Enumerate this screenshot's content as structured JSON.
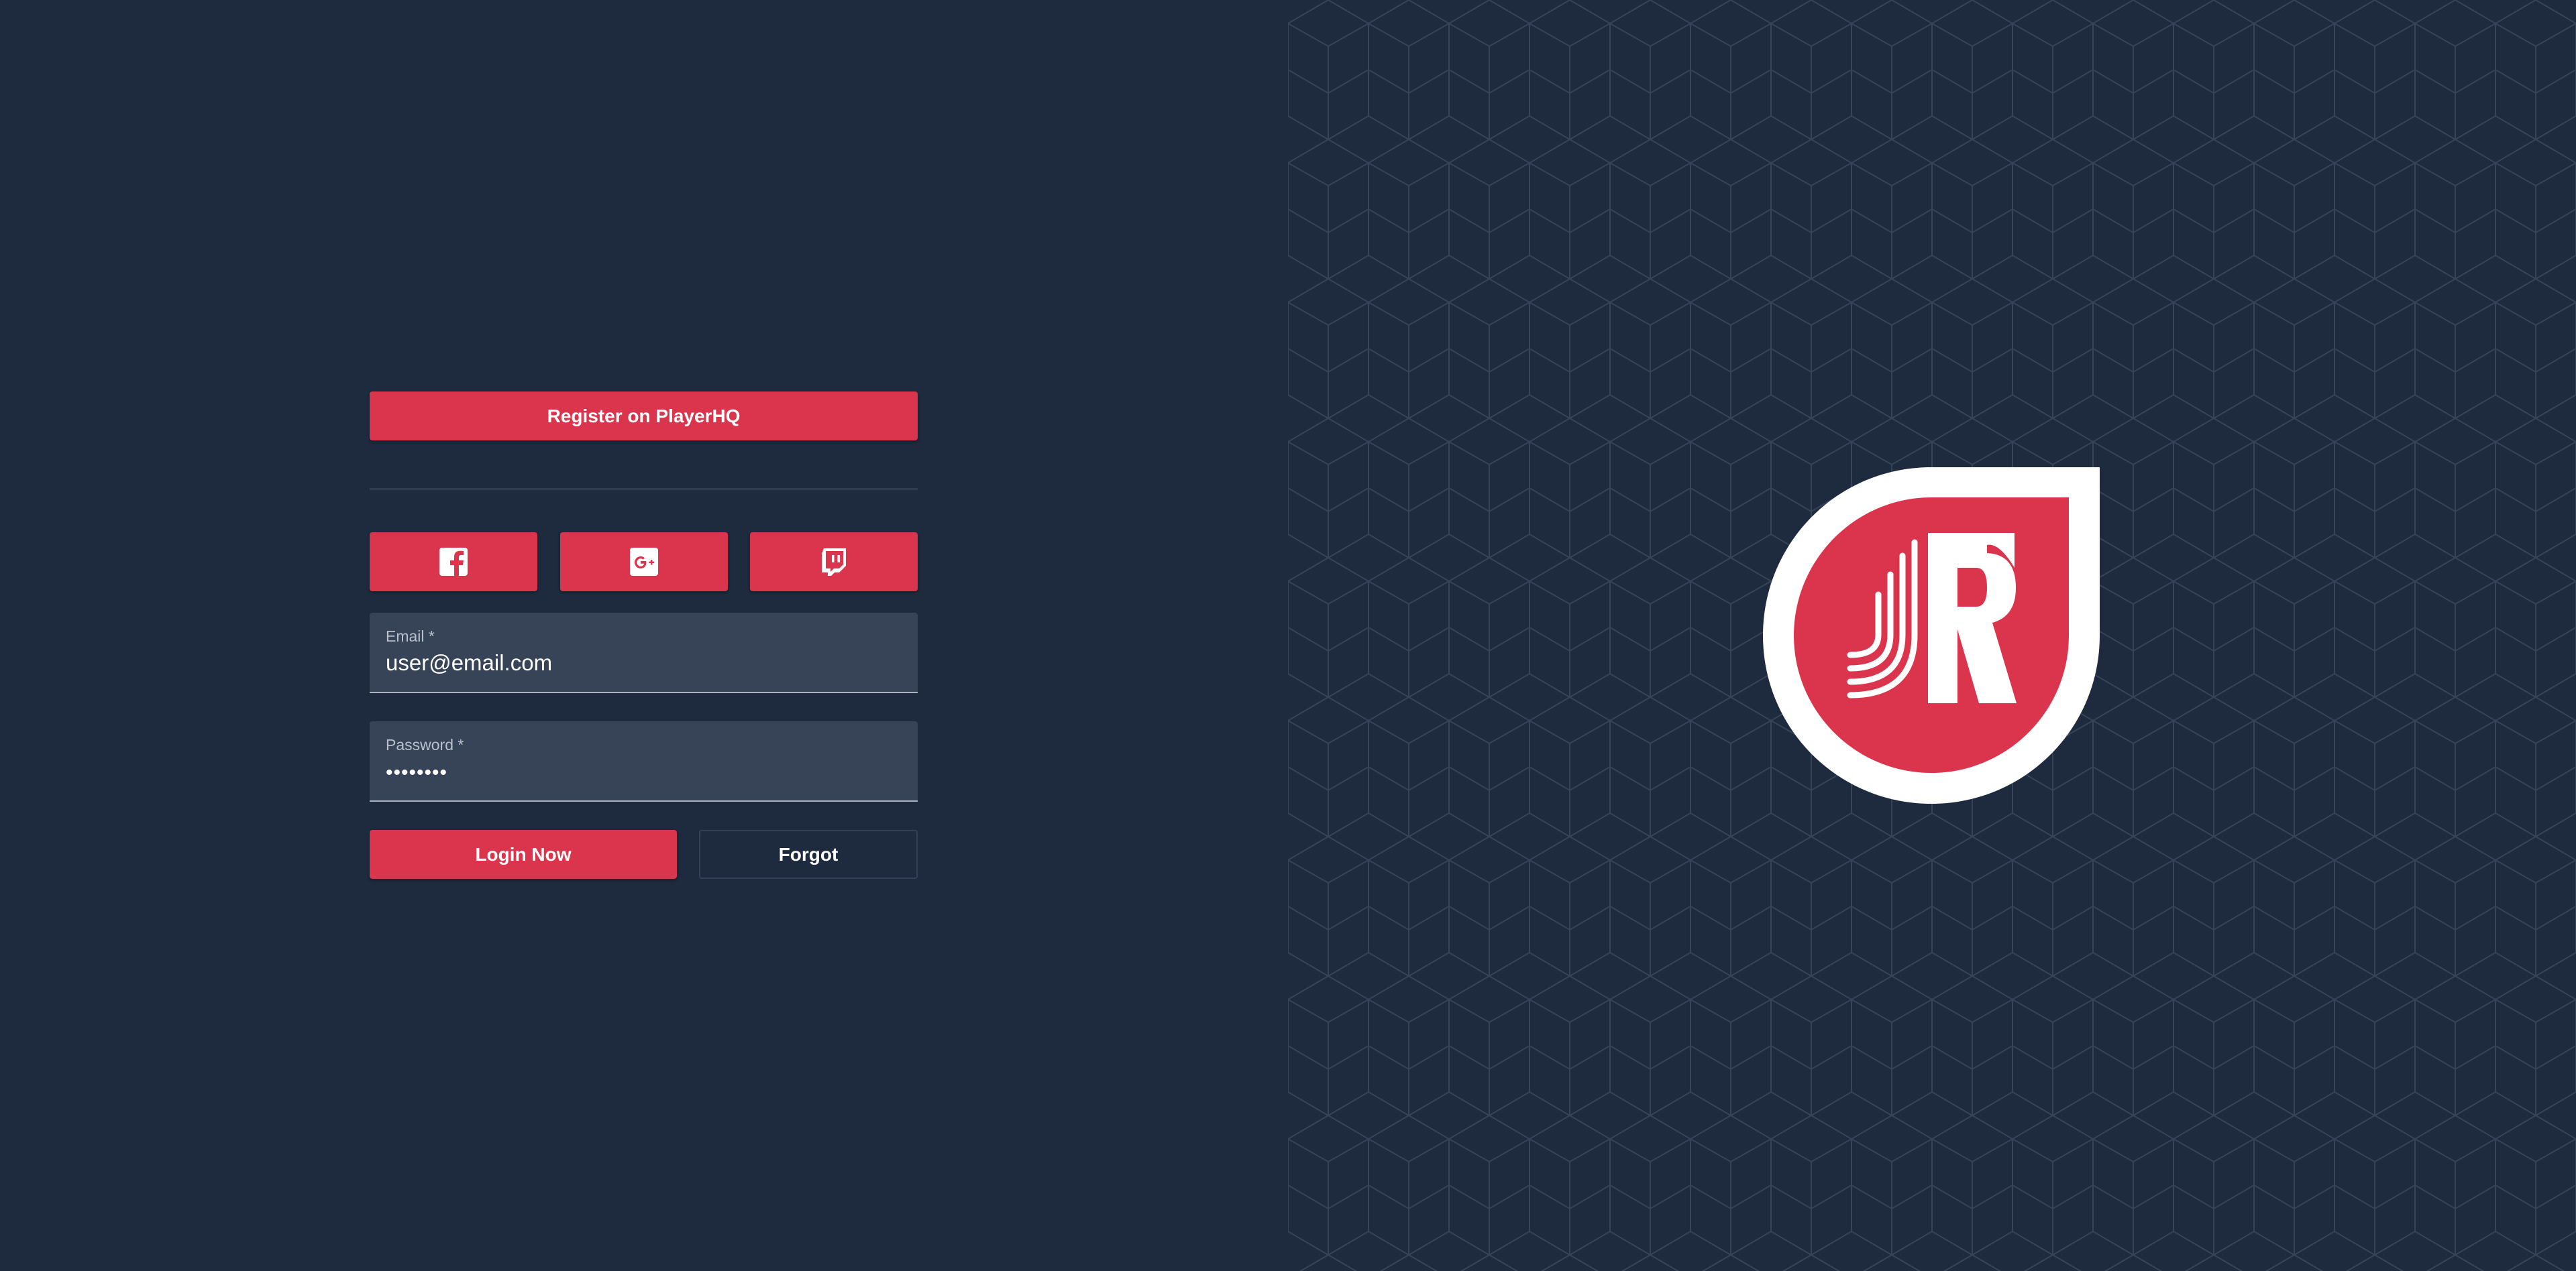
{
  "register": {
    "label": "Register on PlayerHQ"
  },
  "social": {
    "buttons": [
      {
        "name": "facebook",
        "icon": "facebook-icon"
      },
      {
        "name": "google-plus",
        "icon": "google-plus-icon"
      },
      {
        "name": "twitch",
        "icon": "twitch-icon"
      }
    ]
  },
  "login": {
    "email_label": "Email *",
    "email_value": "user@email.com",
    "password_label": "Password *",
    "password_value": "••••••••",
    "login_label": "Login Now",
    "forgot_label": "Forgot"
  },
  "logo": {
    "icon": "brand-logo-icon",
    "letter": "R"
  },
  "colors": {
    "background": "#1e2a3e",
    "accent": "#db344d",
    "field_background": "#374356",
    "text": "#ffffff"
  }
}
